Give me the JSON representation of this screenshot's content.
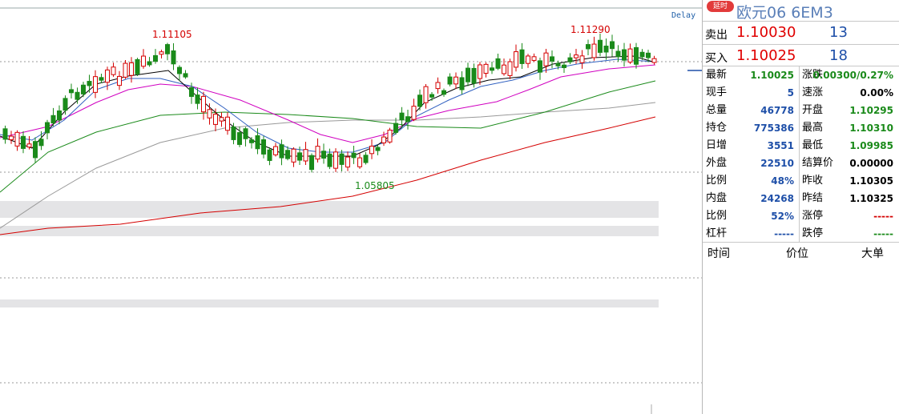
{
  "chart": {
    "delay_label": "Delay",
    "peak_labels": [
      {
        "text": "1.11105",
        "color": "#d40000"
      },
      {
        "text": "1.11290",
        "color": "#d40000"
      },
      {
        "text": "1.05805",
        "color": "#1a8a1a"
      }
    ],
    "colors": {
      "up": "#d40000",
      "down": "#1a8a1a",
      "ma5": "#000000",
      "ma10": "#3060c0",
      "ma20": "#d000c0",
      "ma40": "#1a8a1a",
      "ma60": "#999999",
      "ma120": "#d40000"
    }
  },
  "panel": {
    "badge": "延时",
    "name": "欧元06  6EM3",
    "ask": {
      "label": "卖出",
      "price": "1.10030",
      "volume": "13"
    },
    "bid": {
      "label": "买入",
      "price": "1.10025",
      "volume": "18"
    },
    "left": [
      {
        "k": "最新",
        "v": "1.10025",
        "color": "#1a8a1a"
      },
      {
        "k": "现手",
        "v": "5",
        "color": "#1e4fa8"
      },
      {
        "k": "总量",
        "v": "46778",
        "color": "#1e4fa8"
      },
      {
        "k": "持仓",
        "v": "775386",
        "color": "#1e4fa8"
      },
      {
        "k": "日增",
        "v": "3551",
        "color": "#1e4fa8"
      },
      {
        "k": "外盘",
        "v": "22510",
        "color": "#1e4fa8"
      },
      {
        "k": "比例",
        "v": "48%",
        "color": "#1e4fa8"
      },
      {
        "k": "内盘",
        "v": "24268",
        "color": "#1e4fa8"
      },
      {
        "k": "比例",
        "v": "52%",
        "color": "#1e4fa8"
      },
      {
        "k": "杠杆",
        "v": "-----",
        "color": "#1e4fa8"
      }
    ],
    "right": [
      {
        "k": "涨跌",
        "v": "0.00300/0.27%",
        "color": "#1a8a1a"
      },
      {
        "k": "速涨",
        "v": "0.00%",
        "color": "#000000"
      },
      {
        "k": "开盘",
        "v": "1.10295",
        "color": "#1a8a1a"
      },
      {
        "k": "最高",
        "v": "1.10310",
        "color": "#1a8a1a"
      },
      {
        "k": "最低",
        "v": "1.09985",
        "color": "#1a8a1a"
      },
      {
        "k": "结算价",
        "v": "0.00000",
        "color": "#000000"
      },
      {
        "k": "昨收",
        "v": "1.10305",
        "color": "#000000"
      },
      {
        "k": "昨结",
        "v": "1.10325",
        "color": "#000000"
      },
      {
        "k": "涨停",
        "v": "-----",
        "color": "#d40000"
      },
      {
        "k": "跌停",
        "v": "-----",
        "color": "#1a8a1a"
      }
    ],
    "footer": {
      "time": "时间",
      "price": "价位",
      "size": "大单"
    }
  }
}
